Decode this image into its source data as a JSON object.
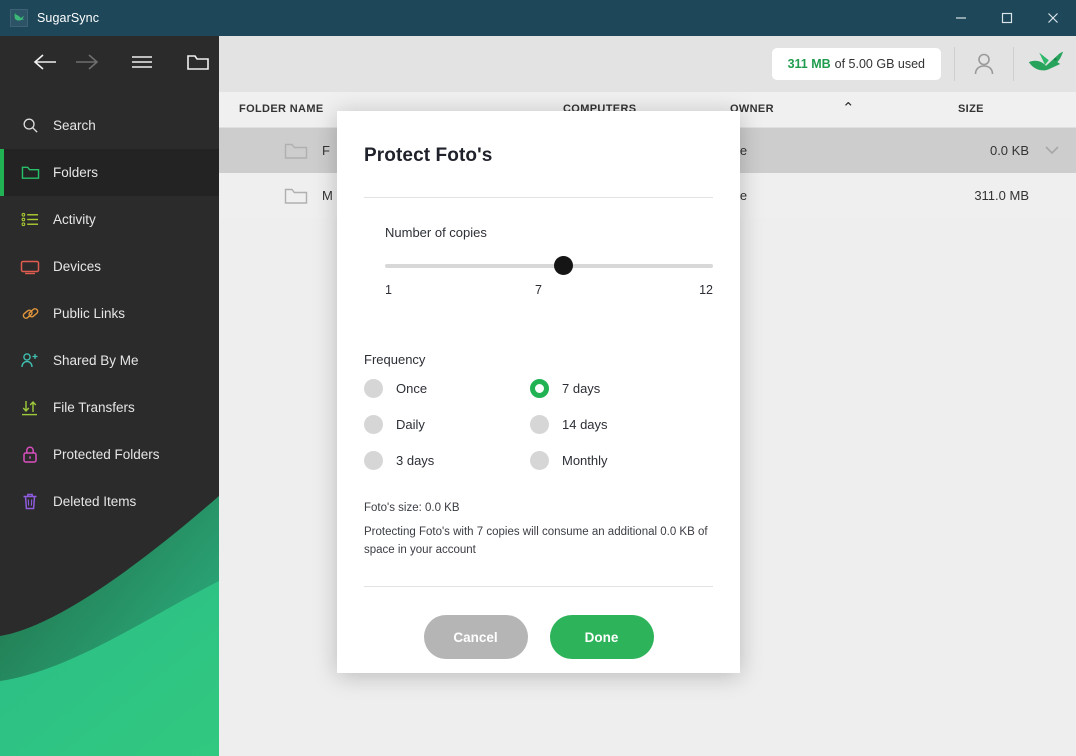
{
  "window": {
    "app_title": "SugarSync",
    "app_icon": "hummingbird-icon",
    "controls": {
      "minimize": "—",
      "maximize": "☐",
      "close": "×"
    }
  },
  "nav_toolbar": {
    "back": "back-arrow-icon",
    "forward": "forward-arrow-icon",
    "menu": "hamburger-menu-icon",
    "new_folder": "new-folder-icon"
  },
  "sidebar": {
    "items": [
      {
        "label": "Search",
        "icon": "search-icon",
        "active": false
      },
      {
        "label": "Folders",
        "icon": "folder-icon",
        "active": true
      },
      {
        "label": "Activity",
        "icon": "activity-list-icon",
        "active": false
      },
      {
        "label": "Devices",
        "icon": "monitor-icon",
        "active": false
      },
      {
        "label": "Public Links",
        "icon": "link-icon",
        "active": false
      },
      {
        "label": "Shared By Me",
        "icon": "person-add-icon",
        "active": false
      },
      {
        "label": "File Transfers",
        "icon": "transfer-arrows-icon",
        "active": false
      },
      {
        "label": "Protected Folders",
        "icon": "lock-icon",
        "active": false
      },
      {
        "label": "Deleted Items",
        "icon": "trash-icon",
        "active": false
      }
    ]
  },
  "topbar": {
    "quota_used": "311 MB",
    "quota_rest": "of 5.00 GB used",
    "account_icon": "user-account-icon",
    "brand_icon": "hummingbird-logo-icon"
  },
  "table": {
    "headers": [
      "FOLDER NAME",
      "COMPUTERS",
      "OWNER",
      "SIZE"
    ],
    "sort_indicator": "⌃",
    "rows": [
      {
        "name": "F",
        "owner": "Me",
        "size": "0.0 KB",
        "selected": true,
        "chevron": "chevron-down-icon"
      },
      {
        "name": "M",
        "owner": "Me",
        "size": "311.0 MB",
        "selected": false,
        "chevron": ""
      }
    ]
  },
  "modal": {
    "title": "Protect Foto's",
    "copies_label": "Number of copies",
    "slider": {
      "min": "1",
      "value": "7",
      "max": "12",
      "min_num": 1,
      "max_num": 12,
      "value_num": 7
    },
    "frequency_label": "Frequency",
    "frequency_options": [
      {
        "label": "Once",
        "selected": false
      },
      {
        "label": "7 days",
        "selected": true
      },
      {
        "label": "Daily",
        "selected": false
      },
      {
        "label": "14 days",
        "selected": false
      },
      {
        "label": "3 days",
        "selected": false
      },
      {
        "label": "Monthly",
        "selected": false
      }
    ],
    "info_line1": "Foto's size: 0.0 KB",
    "info_line2": "Protecting Foto's with 7 copies will consume an additional 0.0 KB of space in your account",
    "cancel_label": "Cancel",
    "done_label": "Done"
  },
  "colors": {
    "titlebar": "#1e475a",
    "accent_green": "#21b353",
    "done_green": "#2db45a",
    "cancel_gray": "#b5b5b5",
    "sidebar": "#2b2b2b"
  }
}
